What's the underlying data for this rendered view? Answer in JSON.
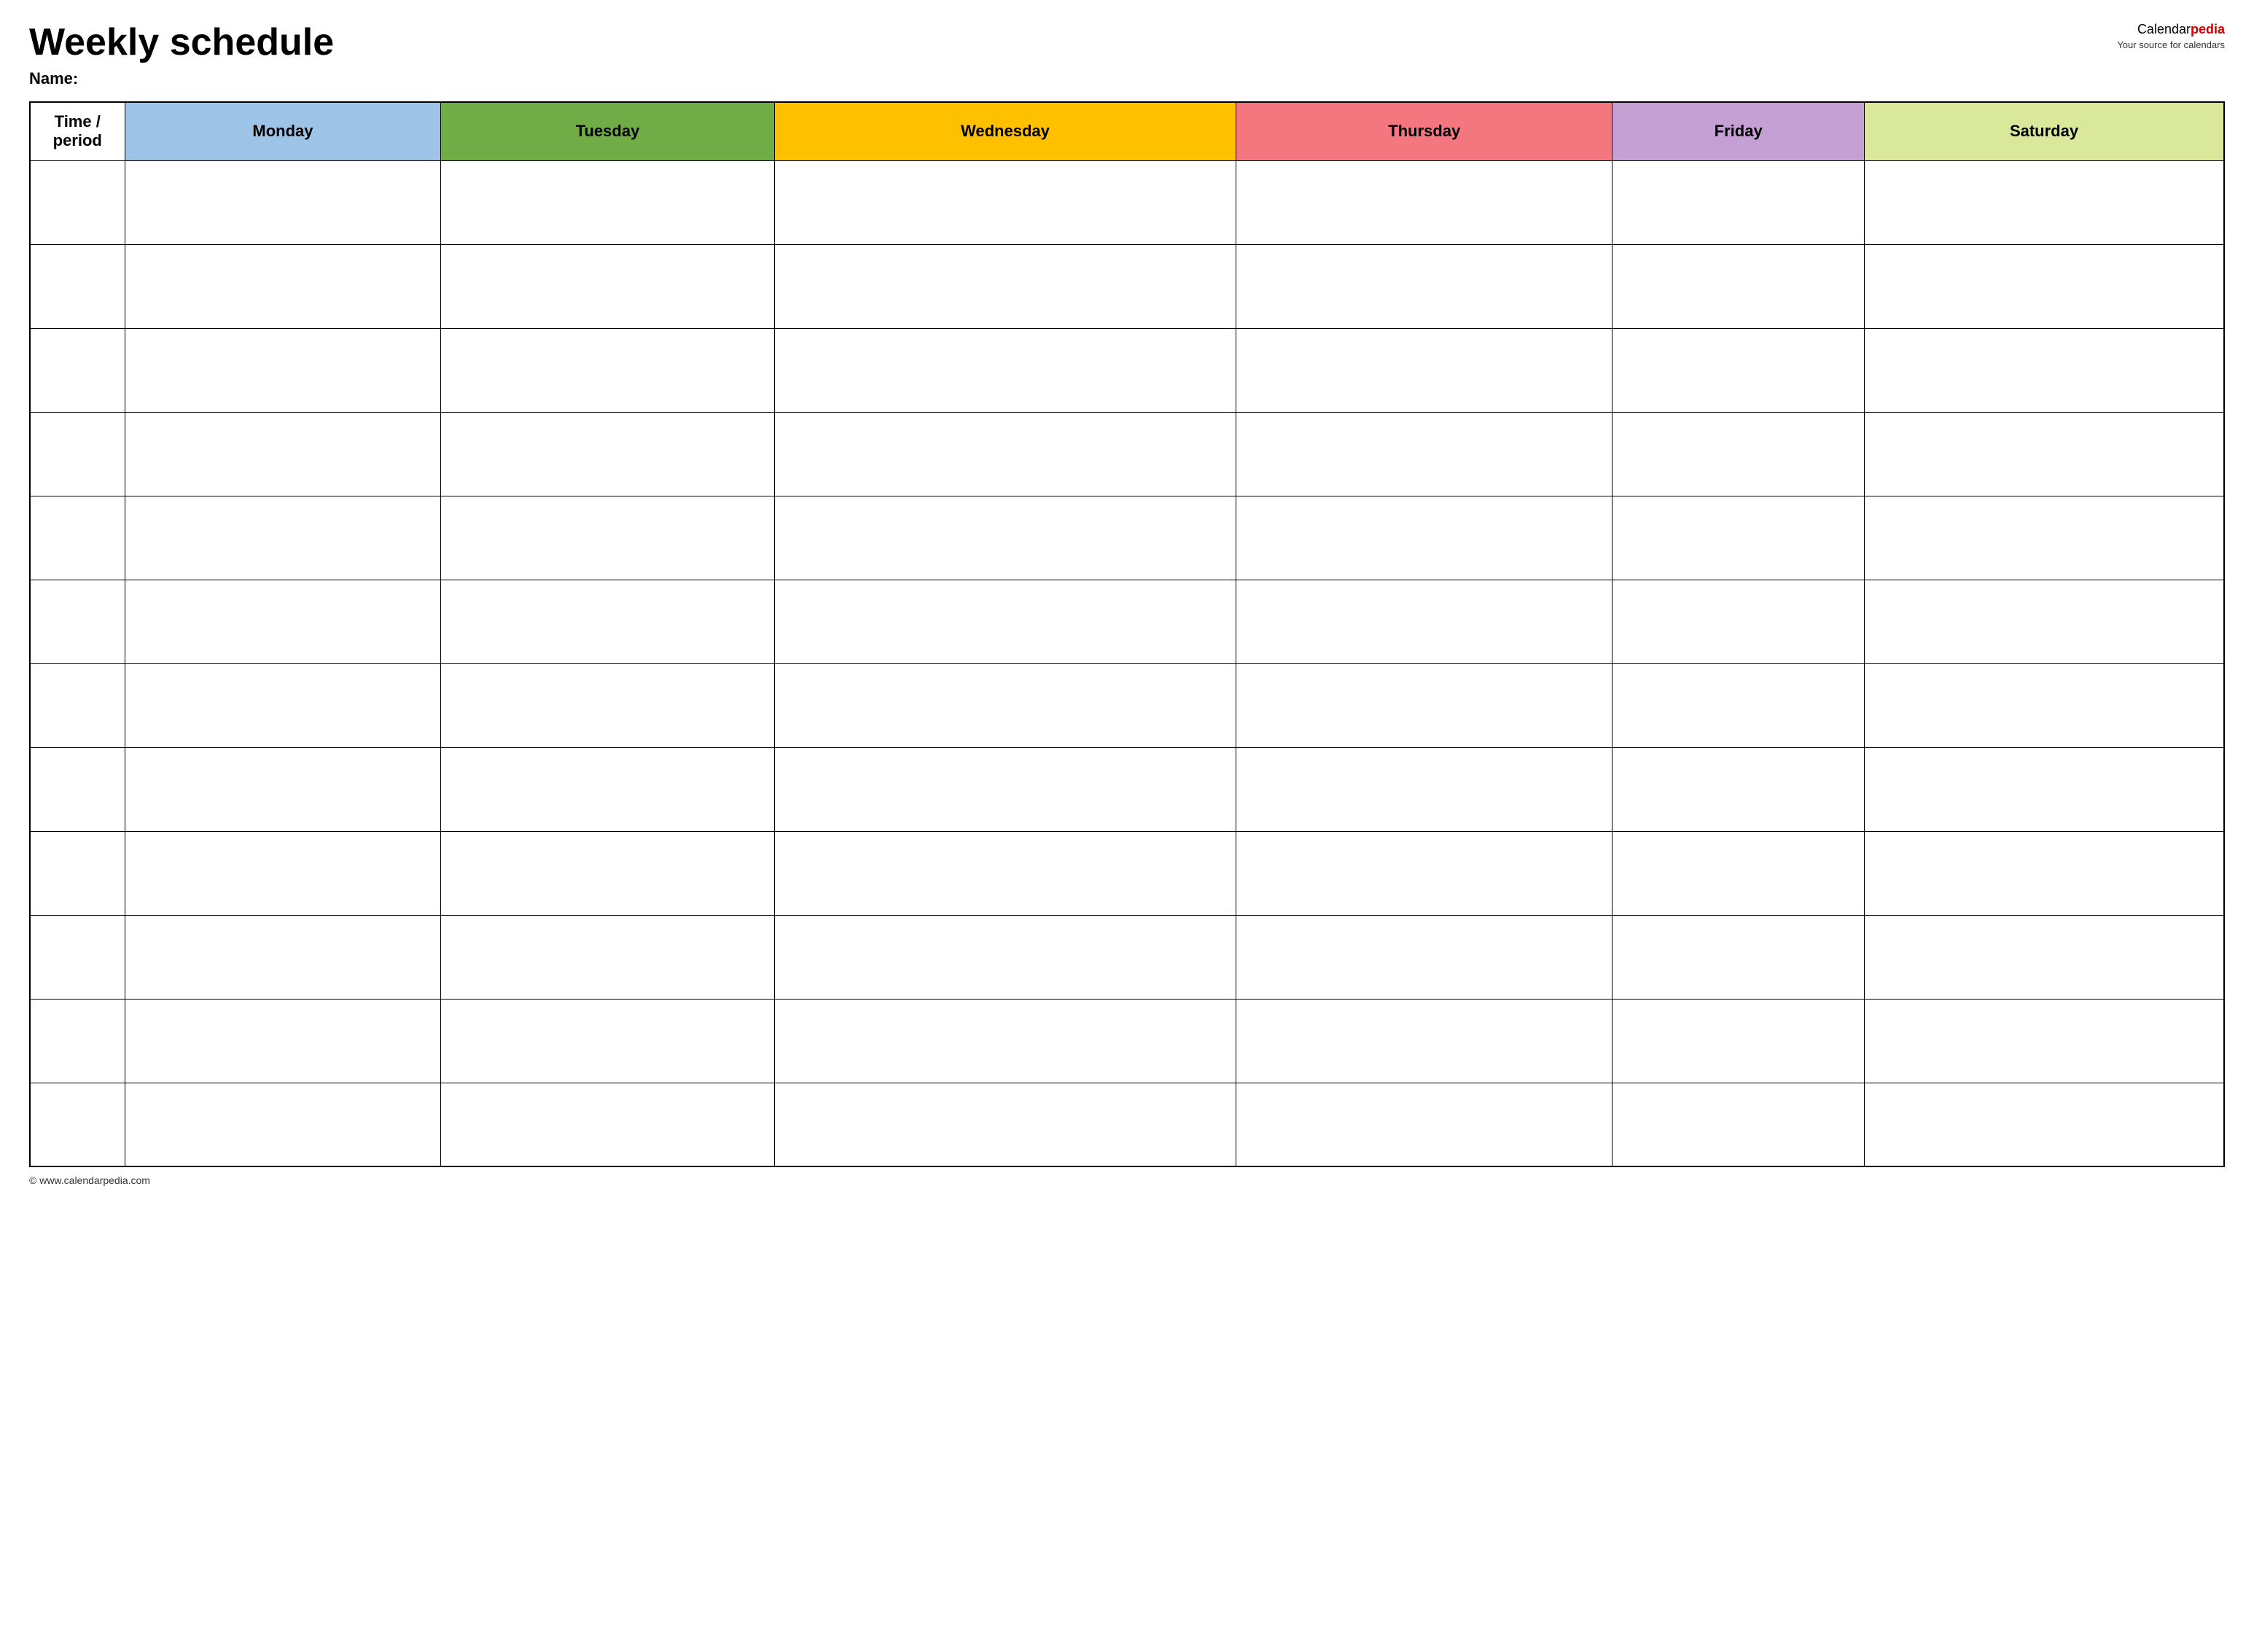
{
  "header": {
    "title": "Weekly schedule",
    "name_label": "Name:",
    "logo_calendar": "Calendar",
    "logo_pedia": "pedia",
    "logo_tagline": "Your source for calendars"
  },
  "table": {
    "columns": [
      {
        "id": "time",
        "label": "Time / period",
        "class": "header-time"
      },
      {
        "id": "monday",
        "label": "Monday",
        "class": "header-monday"
      },
      {
        "id": "tuesday",
        "label": "Tuesday",
        "class": "header-tuesday"
      },
      {
        "id": "wednesday",
        "label": "Wednesday",
        "class": "header-wednesday"
      },
      {
        "id": "thursday",
        "label": "Thursday",
        "class": "header-thursday"
      },
      {
        "id": "friday",
        "label": "Friday",
        "class": "header-friday"
      },
      {
        "id": "saturday",
        "label": "Saturday",
        "class": "header-saturday"
      }
    ],
    "row_count": 12
  },
  "footer": {
    "url": "© www.calendarpedia.com"
  }
}
